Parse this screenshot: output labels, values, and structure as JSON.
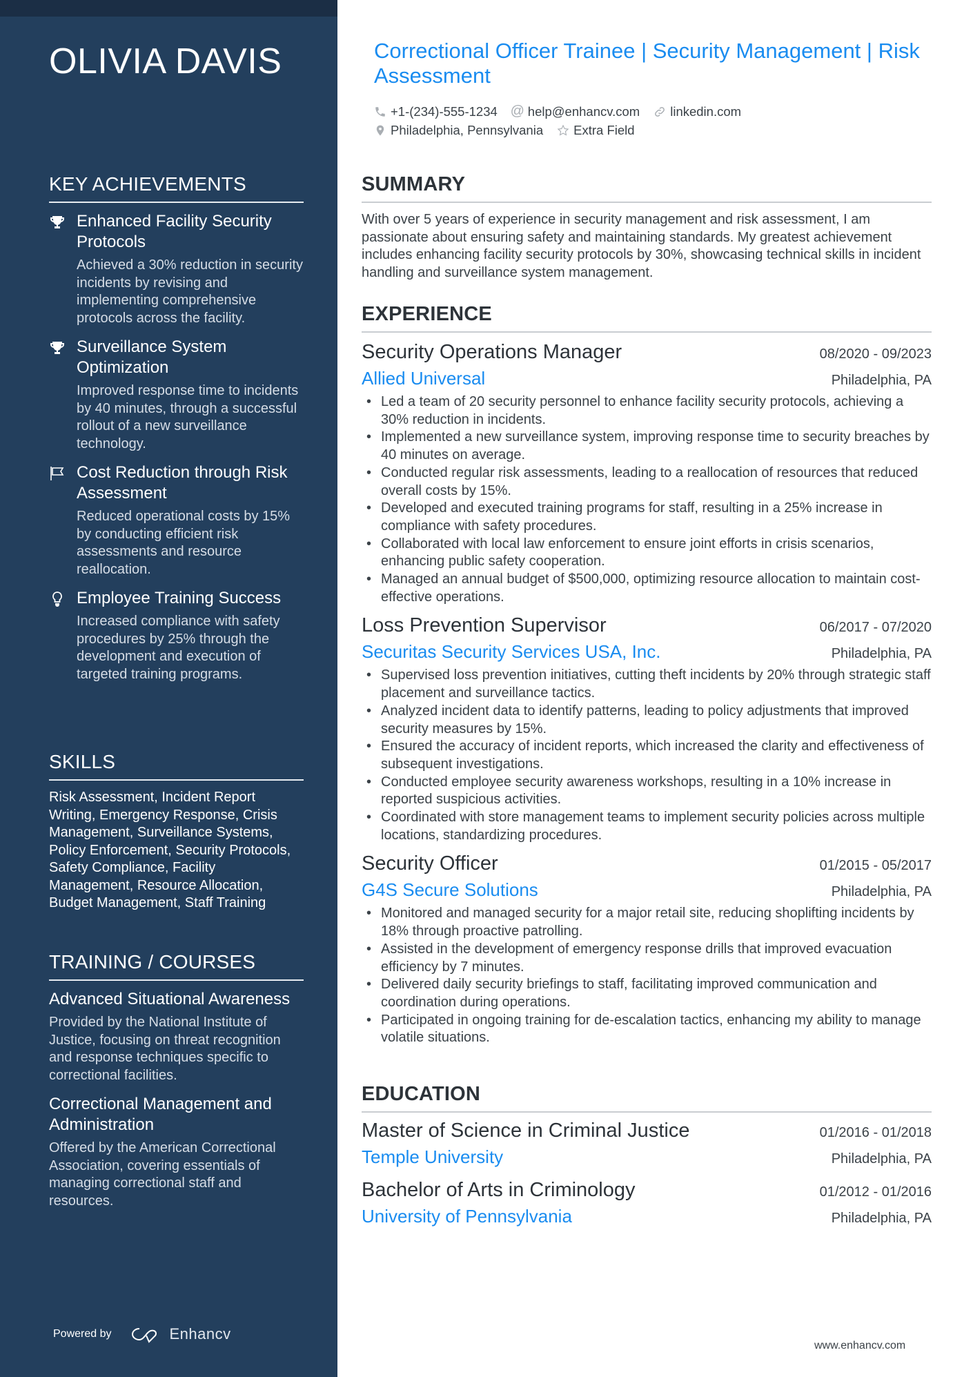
{
  "profile": {
    "name": "OLIVIA DAVIS",
    "headline": "Correctional Officer Trainee | Security Management | Risk Assessment",
    "phone": "+1-(234)-555-1234",
    "email": "help@enhancv.com",
    "link": "linkedin.com",
    "location": "Philadelphia, Pennsylvania",
    "extra": "Extra Field"
  },
  "sidebar": {
    "achievements": {
      "heading": "KEY ACHIEVEMENTS",
      "items": [
        {
          "icon": "trophy-icon",
          "title": "Enhanced Facility Security Protocols",
          "desc": "Achieved a 30% reduction in security incidents by revising and implementing comprehensive protocols across the facility."
        },
        {
          "icon": "trophy-icon",
          "title": "Surveillance System Optimization",
          "desc": "Improved response time to incidents by 40 minutes, through a successful rollout of a new surveillance technology."
        },
        {
          "icon": "flag-icon",
          "title": "Cost Reduction through Risk Assessment",
          "desc": "Reduced operational costs by 15% by conducting efficient risk assessments and resource reallocation."
        },
        {
          "icon": "lightbulb-icon",
          "title": "Employee Training Success",
          "desc": "Increased compliance with safety procedures by 25% through the development and execution of targeted training programs."
        }
      ]
    },
    "skills": {
      "heading": "SKILLS",
      "text": "Risk Assessment, Incident Report Writing, Emergency Response, Crisis Management, Surveillance Systems, Policy Enforcement, Security Protocols, Safety Compliance, Facility Management, Resource Allocation, Budget Management, Staff Training"
    },
    "training": {
      "heading": "TRAINING / COURSES",
      "items": [
        {
          "title": "Advanced Situational Awareness",
          "desc": "Provided by the National Institute of Justice, focusing on threat recognition and response techniques specific to correctional facilities."
        },
        {
          "title": "Correctional Management and Administration",
          "desc": "Offered by the American Correctional Association, covering essentials of managing correctional staff and resources."
        }
      ]
    },
    "footer": {
      "powered_by": "Powered by",
      "brand": "Enhancv"
    }
  },
  "main": {
    "summary": {
      "heading": "SUMMARY",
      "text": "With over 5 years of experience in security management and risk assessment, I am passionate about ensuring safety and maintaining standards. My greatest achievement includes enhancing facility security protocols by 30%, showcasing technical skills in incident handling and surveillance system management."
    },
    "experience": {
      "heading": "EXPERIENCE",
      "jobs": [
        {
          "title": "Security Operations Manager",
          "dates": "08/2020 - 09/2023",
          "company": "Allied Universal",
          "location": "Philadelphia, PA",
          "bullets": [
            "Led a team of 20 security personnel to enhance facility security protocols, achieving a 30% reduction in incidents.",
            "Implemented a new surveillance system, improving response time to security breaches by 40 minutes on average.",
            "Conducted regular risk assessments, leading to a reallocation of resources that reduced overall costs by 15%.",
            "Developed and executed training programs for staff, resulting in a 25% increase in compliance with safety procedures.",
            "Collaborated with local law enforcement to ensure joint efforts in crisis scenarios, enhancing public safety cooperation.",
            "Managed an annual budget of $500,000, optimizing resource allocation to maintain cost-effective operations."
          ]
        },
        {
          "title": "Loss Prevention Supervisor",
          "dates": "06/2017 - 07/2020",
          "company": "Securitas Security Services USA, Inc.",
          "location": "Philadelphia, PA",
          "bullets": [
            "Supervised loss prevention initiatives, cutting theft incidents by 20% through strategic staff placement and surveillance tactics.",
            "Analyzed incident data to identify patterns, leading to policy adjustments that improved security measures by 15%.",
            "Ensured the accuracy of incident reports, which increased the clarity and effectiveness of subsequent investigations.",
            "Conducted employee security awareness workshops, resulting in a 10% increase in reported suspicious activities.",
            "Coordinated with store management teams to implement security policies across multiple locations, standardizing procedures."
          ]
        },
        {
          "title": "Security Officer",
          "dates": "01/2015 - 05/2017",
          "company": "G4S Secure Solutions",
          "location": "Philadelphia, PA",
          "bullets": [
            "Monitored and managed security for a major retail site, reducing shoplifting incidents by 18% through proactive patrolling.",
            "Assisted in the development of emergency response drills that improved evacuation efficiency by 7 minutes.",
            "Delivered daily security briefings to staff, facilitating improved communication and coordination during operations.",
            "Participated in ongoing training for de-escalation tactics, enhancing my ability to manage volatile situations."
          ]
        }
      ]
    },
    "education": {
      "heading": "EDUCATION",
      "items": [
        {
          "degree": "Master of Science in Criminal Justice",
          "dates": "01/2016 - 01/2018",
          "school": "Temple University",
          "location": "Philadelphia, PA"
        },
        {
          "degree": "Bachelor of Arts in Criminology",
          "dates": "01/2012 - 01/2016",
          "school": "University of Pennsylvania",
          "location": "Philadelphia, PA"
        }
      ]
    },
    "footer": {
      "url": "www.enhancv.com"
    }
  },
  "colors": {
    "sidebar_bg": "#233f5d",
    "accent_blue": "#1a8cf0",
    "text_dark": "#2d3339"
  }
}
